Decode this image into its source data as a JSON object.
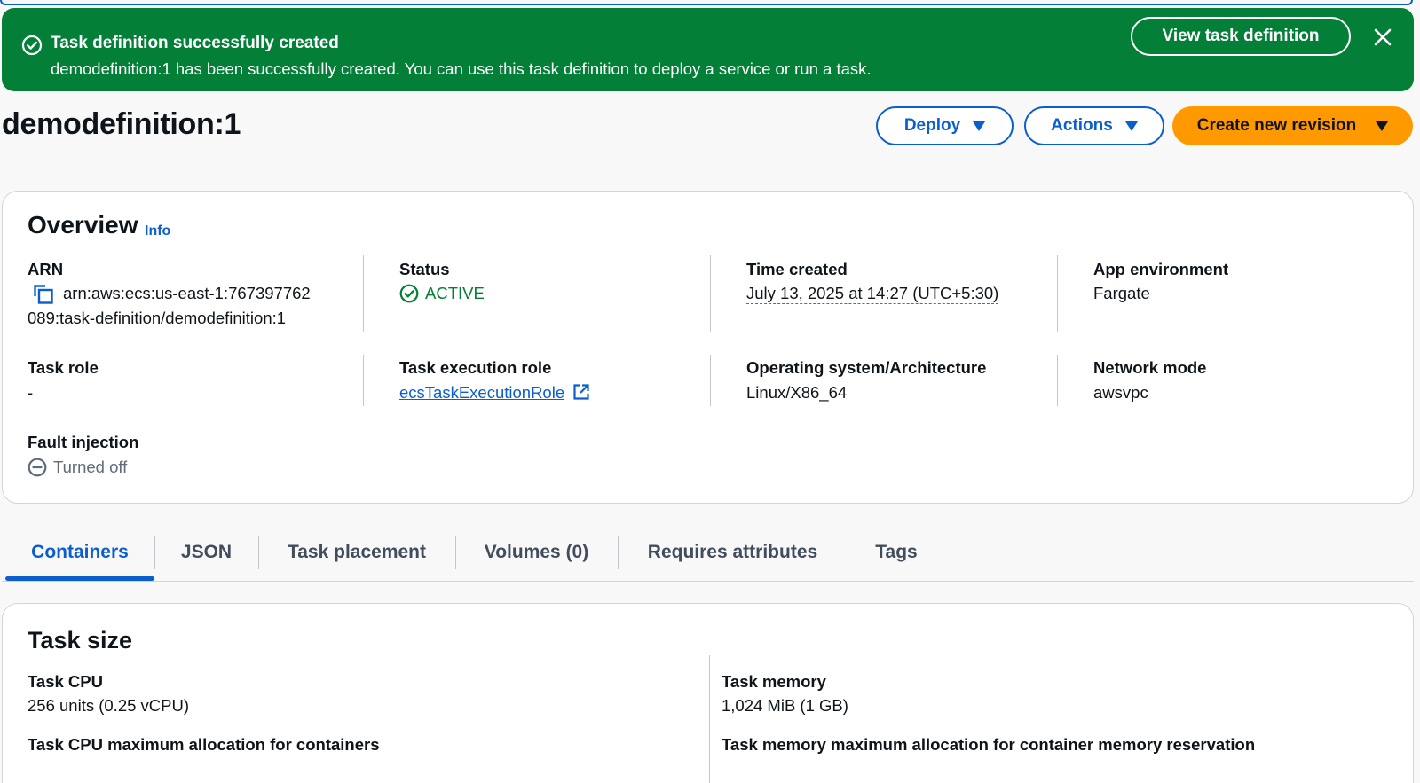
{
  "flash": {
    "title": "Task definition successfully created",
    "message": "demodefinition:1 has been successfully created. You can use this task definition to deploy a service or run a task.",
    "view_button": "View task definition",
    "color": "#037f37"
  },
  "header": {
    "title": "demodefinition:1",
    "deploy_label": "Deploy",
    "actions_label": "Actions",
    "create_revision_label": "Create new revision",
    "accent": "#0b5fcc",
    "primary_color": "#ff9900"
  },
  "overview": {
    "title": "Overview",
    "info": "Info",
    "arn_label": "ARN",
    "arn_line1": "arn:aws:ecs:us-east-1:767397762",
    "arn_line2": "089:task-definition/demodefinition:1",
    "status_label": "Status",
    "status_value": "ACTIVE",
    "time_label": "Time created",
    "time_value": "July 13, 2025 at 14:27 (UTC+5:30)",
    "appenv_label": "App environment",
    "appenv_value": "Fargate",
    "taskrole_label": "Task role",
    "taskrole_value": "-",
    "execrole_label": "Task execution role",
    "execrole_value": "ecsTaskExecutionRole",
    "os_label": "Operating system/Architecture",
    "os_value": "Linux/X86_64",
    "network_label": "Network mode",
    "network_value": "awsvpc",
    "fault_label": "Fault injection",
    "fault_value": "Turned off"
  },
  "tabs": [
    {
      "label": "Containers"
    },
    {
      "label": "JSON"
    },
    {
      "label": "Task placement"
    },
    {
      "label": "Volumes (0)"
    },
    {
      "label": "Requires attributes"
    },
    {
      "label": "Tags"
    }
  ],
  "task_size": {
    "title": "Task size",
    "cpu_label": "Task CPU",
    "cpu_value": "256 units (0.25 vCPU)",
    "memory_label": "Task memory",
    "memory_value": "1,024 MiB (1 GB)",
    "cpu_max_label": "Task CPU maximum allocation for containers",
    "memory_max_label": "Task memory maximum allocation for container memory reservation"
  }
}
